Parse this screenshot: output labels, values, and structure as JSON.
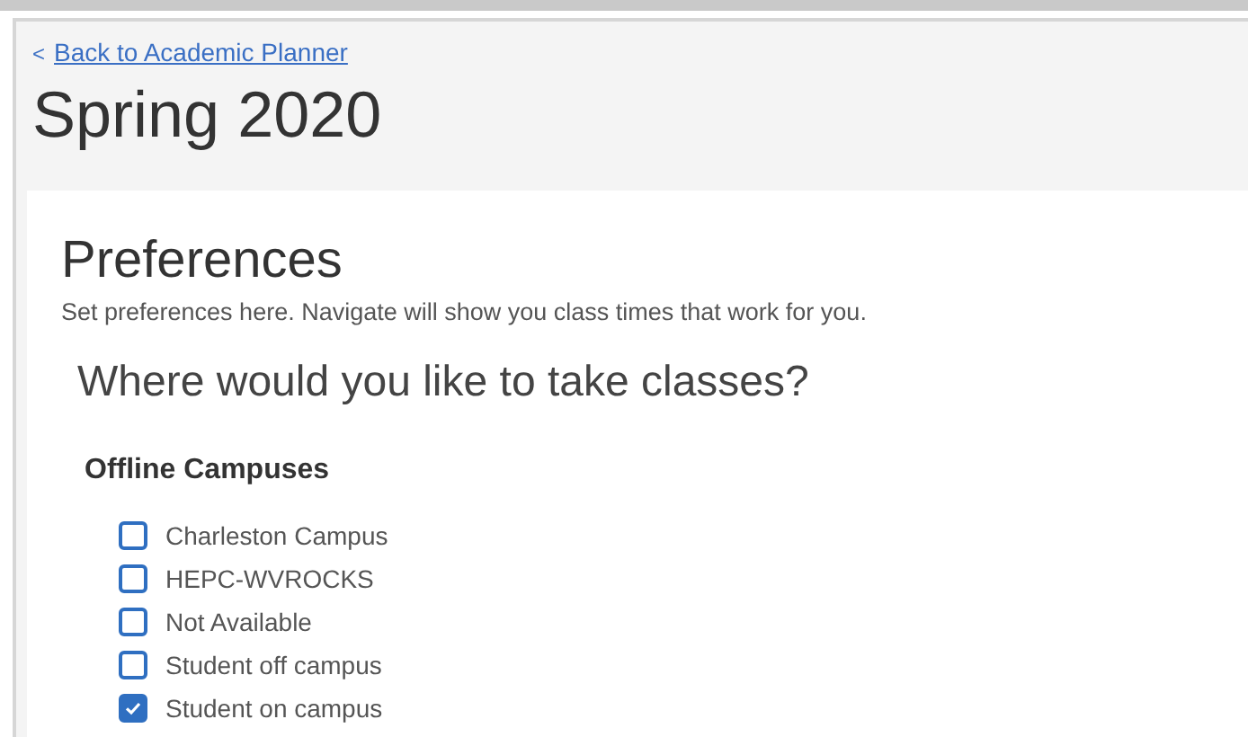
{
  "back_link": {
    "icon": "<",
    "label": "Back to Academic Planner"
  },
  "term_title": "Spring 2020",
  "preferences": {
    "title": "Preferences",
    "description": "Set preferences here. Navigate will show you class times that work for you.",
    "question": "Where would you like to take classes?",
    "group_title": "Offline Campuses",
    "options": [
      {
        "label": "Charleston Campus",
        "checked": false
      },
      {
        "label": "HEPC-WVROCKS",
        "checked": false
      },
      {
        "label": "Not Available",
        "checked": false
      },
      {
        "label": "Student off campus",
        "checked": false
      },
      {
        "label": "Student on campus",
        "checked": true
      }
    ]
  }
}
